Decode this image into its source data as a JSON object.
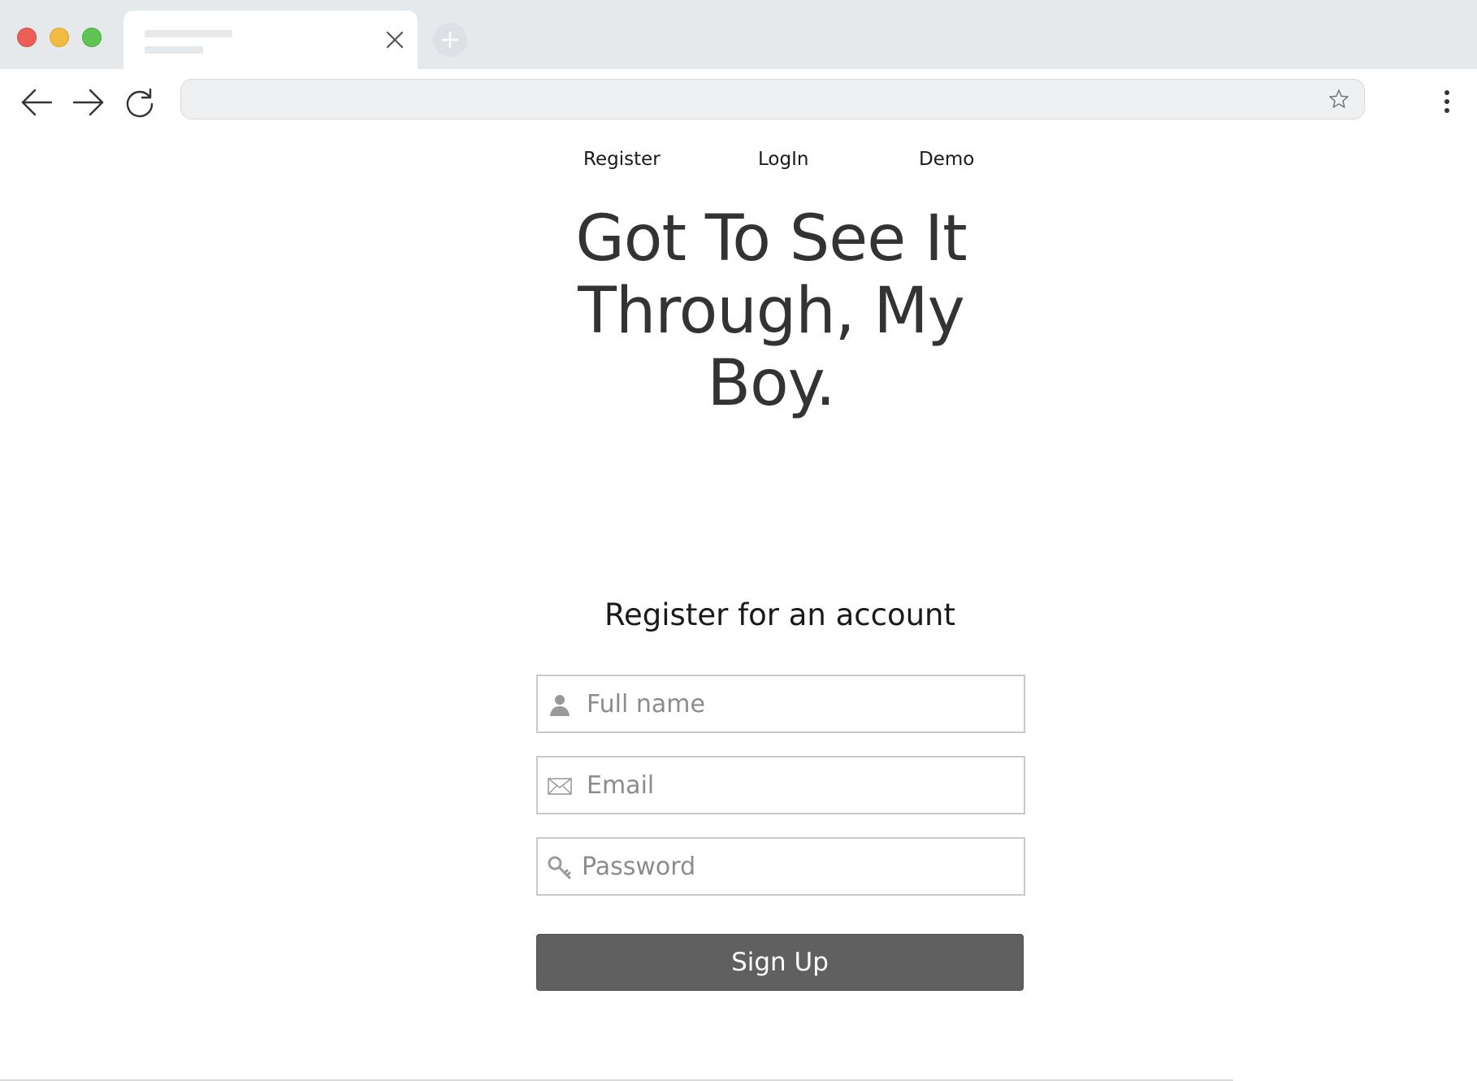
{
  "browser": {
    "window_controls": [
      "close",
      "minimize",
      "maximize"
    ],
    "tab": {
      "close_icon": "close-icon"
    },
    "new_tab_icon": "plus-icon",
    "toolbar": {
      "back_icon": "arrow-left-icon",
      "forward_icon": "arrow-right-icon",
      "reload_icon": "reload-icon",
      "bookmark_icon": "star-icon",
      "menu_icon": "more-vertical-icon"
    },
    "address_value": ""
  },
  "nav": {
    "register": "Register",
    "login": "LogIn",
    "demo": "Demo"
  },
  "hero": {
    "line1": "Got To See It",
    "line2": "Through, My",
    "line3": "Boy."
  },
  "form": {
    "title": "Register for an account",
    "full_name": {
      "placeholder": "Full name",
      "value": "",
      "icon": "user-icon"
    },
    "email": {
      "placeholder": "Email",
      "value": "",
      "icon": "envelope-icon"
    },
    "password": {
      "placeholder": "Password",
      "value": "",
      "icon": "key-icon"
    },
    "submit": "Sign Up"
  },
  "colors": {
    "traffic_red": "#ec5f57",
    "traffic_yellow": "#f2bc42",
    "traffic_green": "#5ec454",
    "chrome_bg": "#e6e9ec",
    "button_bg": "#606060",
    "heading_text": "#333333"
  }
}
